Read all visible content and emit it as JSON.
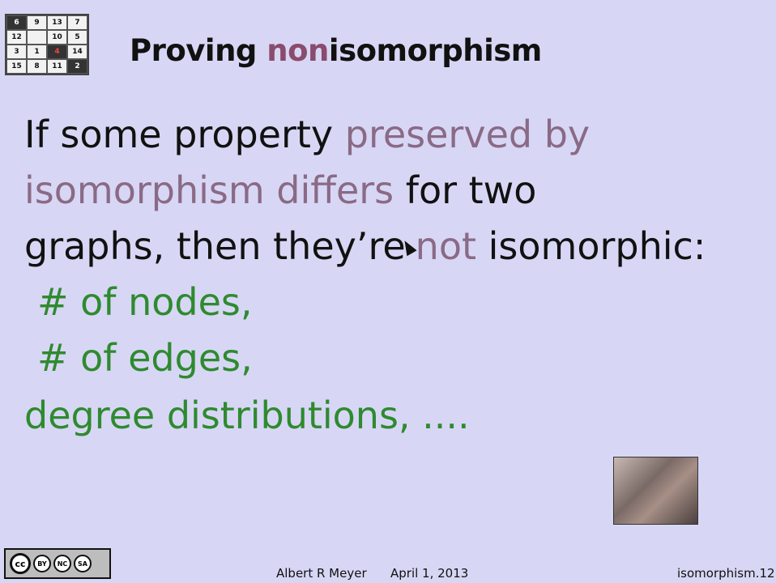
{
  "puzzle": {
    "cells": [
      {
        "text": "6",
        "style": "dark"
      },
      {
        "text": "9",
        "style": "plain"
      },
      {
        "text": "13",
        "style": "plain"
      },
      {
        "text": "7",
        "style": "plain"
      },
      {
        "text": "12",
        "style": "plain"
      },
      {
        "text": "",
        "style": "empty"
      },
      {
        "text": "10",
        "style": "plain"
      },
      {
        "text": "5",
        "style": "plain"
      },
      {
        "text": "3",
        "style": "plain"
      },
      {
        "text": "1",
        "style": "plain"
      },
      {
        "text": "4",
        "style": "red"
      },
      {
        "text": "14",
        "style": "plain"
      },
      {
        "text": "15",
        "style": "plain"
      },
      {
        "text": "8",
        "style": "plain"
      },
      {
        "text": "11",
        "style": "plain"
      },
      {
        "text": "2",
        "style": "dark"
      }
    ]
  },
  "title": {
    "before": "Proving ",
    "highlight": "non",
    "after": "isomorphism"
  },
  "body": {
    "l1_a": "If some property ",
    "l1_b": "preserved by",
    "l2_a": "isomorphism  differs",
    "l2_b": " for two",
    "l3_a": "graphs, then they’re",
    "l3_b": "not",
    "l3_c": " isomorphic:",
    "l4": "# of nodes,",
    "l5": "# of edges,",
    "l6": "degree distributions, ...."
  },
  "license": {
    "cc": "cc",
    "by": "BY",
    "nc": "NC",
    "sa": "SA"
  },
  "footer": {
    "author": "Albert R Meyer",
    "date": "April 1, 2013",
    "slide_id": "isomorphism.12"
  },
  "colors": {
    "background": "#d7d7f5",
    "mauve": "#8a6a86",
    "green": "#2f8a2f"
  }
}
